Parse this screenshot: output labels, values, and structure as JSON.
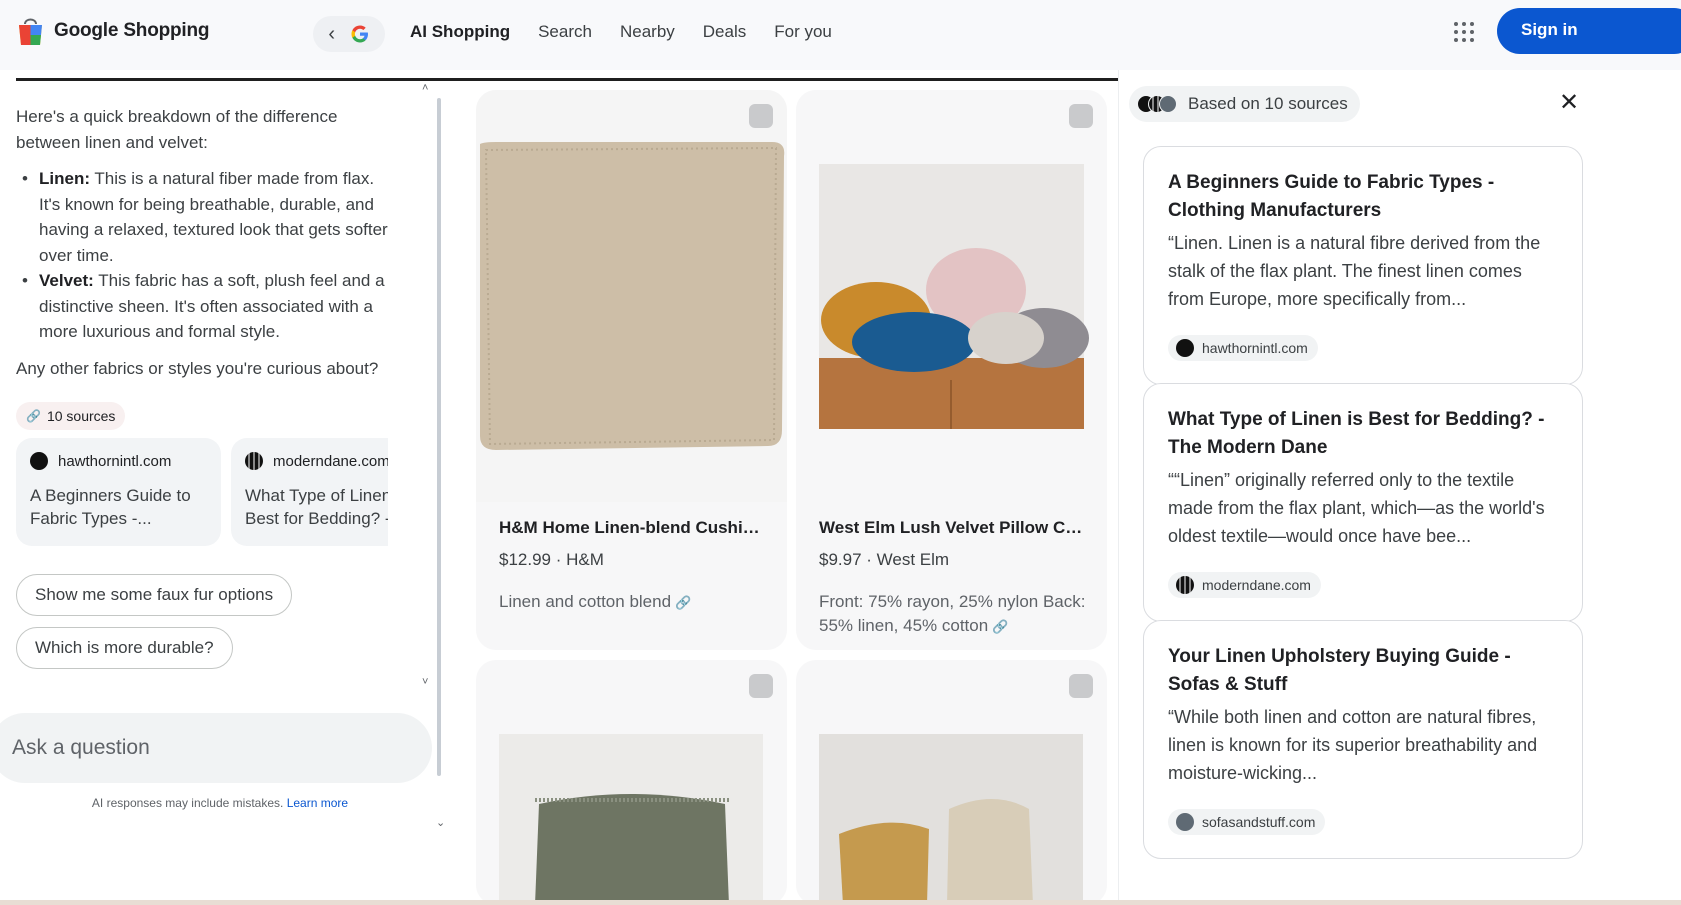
{
  "header": {
    "logo_text": "Google Shopping",
    "back_icon": "chevron-left-icon",
    "google_icon": "google-g-icon",
    "tabs": [
      {
        "label": "AI Shopping",
        "active": true
      },
      {
        "label": "Search"
      },
      {
        "label": "Nearby"
      },
      {
        "label": "Deals"
      },
      {
        "label": "For you"
      }
    ],
    "apps_icon": "apps-grid-icon",
    "signin_label": "Sign in"
  },
  "chat": {
    "intro": "Here's a quick breakdown of the difference between linen and velvet:",
    "bullets": [
      {
        "term": "Linen:",
        "text": "This is a natural fiber made from flax. It's known for being breathable, durable, and having a relaxed, textured look that gets softer over time."
      },
      {
        "term": "Velvet:",
        "text": "This fabric has a soft, plush feel and a distinctive sheen. It's often associated with a more luxurious and formal style."
      }
    ],
    "followup": "Any other fabrics or styles you're curious about?",
    "sources_chip": "10 sources",
    "source_cards": [
      {
        "site": "hawthornintl.com",
        "title": "A Beginners Guide to Fabric Types -..."
      },
      {
        "site": "moderndane.com",
        "title": "What Type of Linen is Best for Bedding? -..."
      }
    ],
    "suggestions": [
      "Show me some faux fur options",
      "Which is more durable?"
    ],
    "ask_placeholder": "Ask a question",
    "disclaimer": "AI responses may include mistakes.",
    "learn_more": "Learn more"
  },
  "products": [
    {
      "name": "H&M Home Linen-blend Cushion...",
      "price": "$12.99 · H&M",
      "desc": "Linen and cotton blend"
    },
    {
      "name": "West Elm Lush Velvet Pillow Cover",
      "price": "$9.97 · West Elm",
      "desc": "Front: 75% rayon, 25% nylon Back: 55% linen, 45% cotton"
    }
  ],
  "sources_panel": {
    "based_label": "Based on 10 sources",
    "close_icon": "close-icon",
    "cards": [
      {
        "title": "A Beginners Guide to Fabric Types - Clothing Manufacturers",
        "snippet": "“Linen. Linen is a natural fibre derived from the stalk of the flax plant. The finest linen comes from Europe, more specifically from...",
        "site": "hawthornintl.com"
      },
      {
        "title": "What Type of Linen is Best for Bedding? - The Modern Dane",
        "snippet": "““Linen” originally referred only to the textile made from the flax plant, which—as the world's oldest textile—would once have bee...",
        "site": "moderndane.com"
      },
      {
        "title": "Your Linen Upholstery Buying Guide - Sofas & Stuff",
        "snippet": "“While both linen and cotton are natural fibres, linen is known for its superior breathability and moisture-wicking...",
        "site": "sofasandstuff.com"
      }
    ]
  },
  "colors": {
    "accent": "#0b57d0",
    "chip_bg": "#f1f3f4",
    "card_bg": "#f7f7f8"
  }
}
